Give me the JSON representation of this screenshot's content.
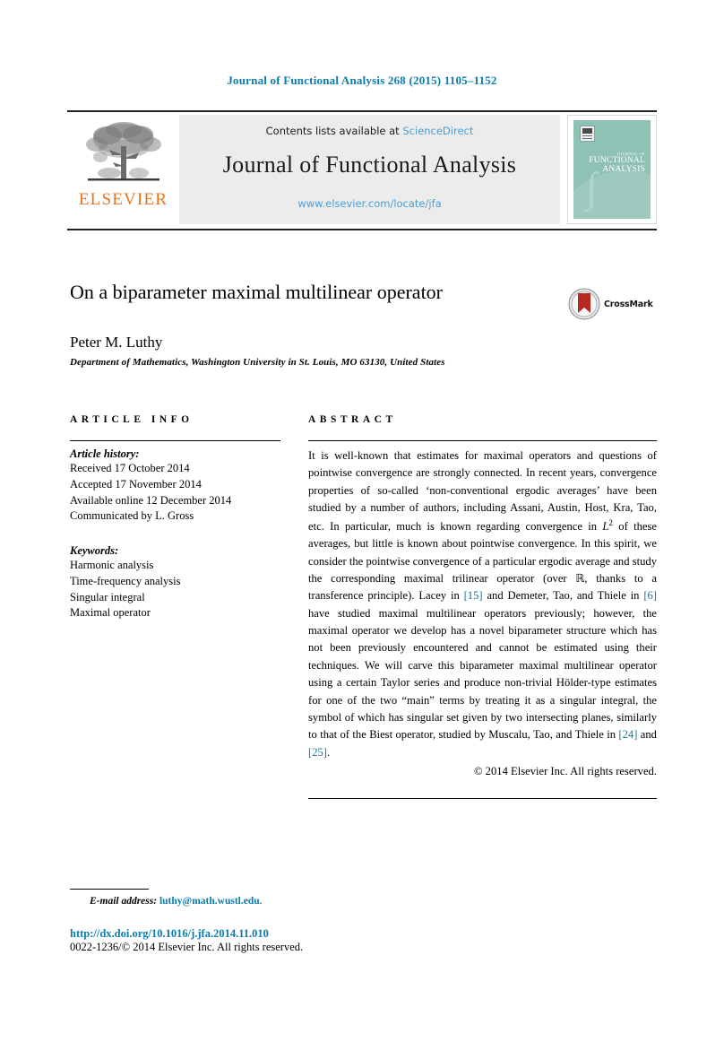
{
  "running_head": "Journal of Functional Analysis 268 (2015) 1105–1152",
  "masthead": {
    "contents_prefix": "Contents lists available at ",
    "sciencedirect": "ScienceDirect",
    "journal_name": "Journal of Functional Analysis",
    "journal_url": "www.elsevier.com/locate/jfa",
    "publisher": "ELSEVIER",
    "cover": {
      "line1": "JOURNAL OF",
      "line2": "FUNCTIONAL",
      "line3": "ANALYSIS"
    }
  },
  "article": {
    "title": "On a biparameter maximal multilinear operator",
    "author": "Peter M. Luthy",
    "affiliation": "Department of Mathematics, Washington University in St. Louis, MO 63130, United States",
    "crossmark_label": "CrossMark"
  },
  "info": {
    "heading": "ARTICLE INFO",
    "history_label": "Article history:",
    "history": [
      "Received 17 October 2014",
      "Accepted 17 November 2014",
      "Available online 12 December 2014",
      "Communicated by L. Gross"
    ],
    "keywords_label": "Keywords:",
    "keywords": [
      "Harmonic analysis",
      "Time-frequency analysis",
      "Singular integral",
      "Maximal operator"
    ]
  },
  "abstract": {
    "heading": "ABSTRACT",
    "part1": "It is well-known that estimates for maximal operators and questions of pointwise convergence are strongly connected. In recent years, convergence properties of so-called ‘non-conventional ergodic averages’ have been studied by a number of authors, including Assani, Austin, Host, Kra, Tao, etc. In particular, much is known regarding convergence in ",
    "l2": "L",
    "l2_sup": "2",
    "part2": " of these averages, but little is known about pointwise convergence. In this spirit, we consider the pointwise convergence of a particular ergodic average and study the corresponding maximal trilinear operator (over ℝ, thanks to a transference principle). Lacey in ",
    "cite1": "[15]",
    "part3": " and Demeter, Tao, and Thiele in ",
    "cite2": "[6]",
    "part4": " have studied maximal multilinear operators previously; however, the maximal operator we develop has a novel biparameter structure which has not been previously encountered and cannot be estimated using their techniques. We will carve this biparameter maximal multilinear operator using a certain Taylor series and produce non-trivial Hölder-type estimates for one of the two “main” terms by treating it as a singular integral, the symbol of which has singular set given by two intersecting planes, similarly to that of the Biest operator, studied by Muscalu, Tao, and Thiele in ",
    "cite3": "[24]",
    "part5": " and ",
    "cite4": "[25]",
    "part6": ".",
    "copyright": "© 2014 Elsevier Inc. All rights reserved."
  },
  "footer": {
    "email_label": "E-mail address:",
    "email": "luthy@math.wustl.edu",
    "email_period": ".",
    "doi": "http://dx.doi.org/10.1016/j.jfa.2014.11.010",
    "issn": "0022-1236/© 2014 Elsevier Inc. All rights reserved."
  },
  "colors": {
    "link_blue": "#0b7cad",
    "light_blue": "#4a9fd4",
    "elsevier_orange": "#e87422",
    "cover_teal": "#8fc1b5",
    "crossmark_red": "#b5291f"
  }
}
